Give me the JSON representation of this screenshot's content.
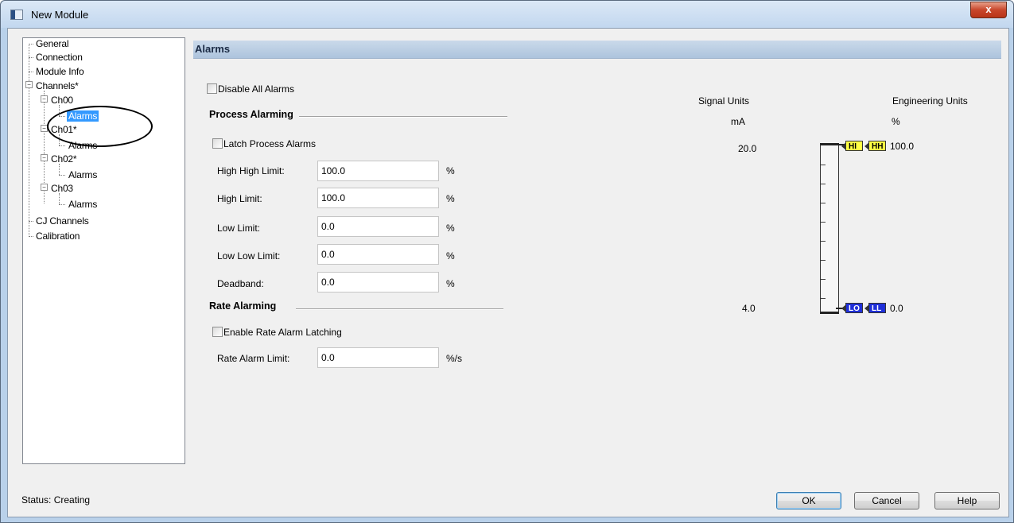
{
  "window": {
    "title": "New Module",
    "close_glyph": "x"
  },
  "tree": {
    "items": [
      {
        "label": "General"
      },
      {
        "label": "Connection"
      },
      {
        "label": "Module Info"
      },
      {
        "label": "Channels*"
      },
      {
        "label": "Ch00"
      },
      {
        "label": "Alarms",
        "selected": true
      },
      {
        "label": "Ch01*"
      },
      {
        "label": "Alarms"
      },
      {
        "label": "Ch02*"
      },
      {
        "label": "Alarms"
      },
      {
        "label": "Ch03"
      },
      {
        "label": "Alarms"
      },
      {
        "label": "CJ Channels"
      },
      {
        "label": "Calibration"
      }
    ],
    "expander_glyph": "−"
  },
  "panel": {
    "title": "Alarms",
    "disable_all_alarms": "Disable All Alarms",
    "process_alarming": {
      "heading": "Process Alarming",
      "latch_label": "Latch Process Alarms",
      "fields": [
        {
          "label": "High High Limit:",
          "value": "100.0",
          "unit": "%"
        },
        {
          "label": "High Limit:",
          "value": "100.0",
          "unit": "%"
        },
        {
          "label": "Low Limit:",
          "value": "0.0",
          "unit": "%"
        },
        {
          "label": "Low Low Limit:",
          "value": "0.0",
          "unit": "%"
        },
        {
          "label": "Deadband:",
          "value": "0.0",
          "unit": "%"
        }
      ]
    },
    "rate_alarming": {
      "heading": "Rate Alarming",
      "latch_label": "Enable Rate Alarm Latching",
      "limit_label": "Rate Alarm Limit:",
      "limit_value": "0.0",
      "limit_unit": "%/s"
    },
    "gauge": {
      "signal_units_label": "Signal Units",
      "signal_unit": "mA",
      "engineering_units_label": "Engineering Units",
      "engineering_unit": "%",
      "signal_high": "20.0",
      "signal_low": "4.0",
      "eng_high": "100.0",
      "eng_low": "0.0",
      "flag_hi": "HI",
      "flag_hh": "HH",
      "flag_lo": "LO",
      "flag_ll": "LL",
      "colors": {
        "high_flag": "#ffff44",
        "low_flag": "#1f2fd8"
      }
    }
  },
  "footer": {
    "status": "Status:  Creating",
    "ok": "OK",
    "cancel": "Cancel",
    "help": "Help"
  }
}
